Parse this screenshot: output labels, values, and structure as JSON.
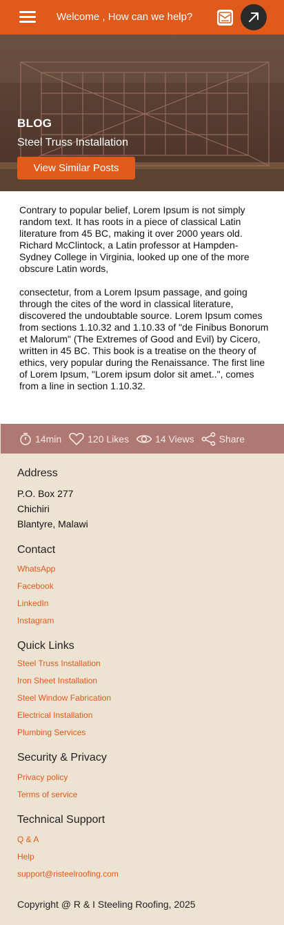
{
  "header": {
    "welcome_text": "Welcome , How can we help?",
    "menu_icon": "hamburger-menu-icon",
    "mail_icon": "mail-icon",
    "action_icon": "arrow-up-right-icon"
  },
  "hero": {
    "kicker": "BLOG",
    "title": "Steel Truss Installation",
    "button_label": "View Similar Posts"
  },
  "article": {
    "paragraphs": [
      "Contrary to popular belief, Lorem Ipsum is not simply random text. It has roots in a piece of classical Latin literature from 45 BC, making it over 2000 years old. Richard McClintock, a Latin professor at Hampden-Sydney College in Virginia, looked up one of the more obscure Latin words,",
      "consectetur, from a Lorem Ipsum passage, and going through the cites of the word in classical literature, discovered the undoubtable source. Lorem Ipsum comes from sections 1.10.32 and 1.10.33 of \"de Finibus Bonorum et Malorum\" (The Extremes of Good and Evil) by Cicero, written in 45 BC. This book is a treatise on the theory of ethics, very popular during the Renaissance. The first line of Lorem Ipsum, \"Lorem ipsum dolor sit amet..\", comes from a line in section 1.10.32."
    ]
  },
  "stats": {
    "read_time": "14min",
    "likes": "120 Likes",
    "views": "14 Views",
    "share": "Share"
  },
  "footer": {
    "address_heading": "Address",
    "address_lines": [
      "P.O. Box 277",
      "Chichiri",
      "Blantyre, Malawi"
    ],
    "contact_heading": "Contact",
    "contact_links": [
      "WhatsApp",
      "Facebook",
      "LinkedIn",
      "Instagram"
    ],
    "quick_heading": "Quick Links",
    "quick_links": [
      "Steel Truss Installation",
      "Iron Sheet Installation",
      "Steel Window Fabrication",
      "Electrical Installation",
      "Plumbing Services"
    ],
    "security_heading": "Security & Privacy",
    "security_links": [
      "Privacy policy",
      "Terms of service"
    ],
    "support_heading": "Technical Support",
    "support_links": [
      "Q & A",
      "Help",
      "support@risteelroofing.com"
    ],
    "copyright": "Copyright @ R & I Steeling Roofing, 2025"
  },
  "colors": {
    "brand_orange": "#e05a1c",
    "footer_bg": "#ede3d3",
    "stats_bg": "#b07872",
    "fab_bg": "#2a2a2a"
  }
}
